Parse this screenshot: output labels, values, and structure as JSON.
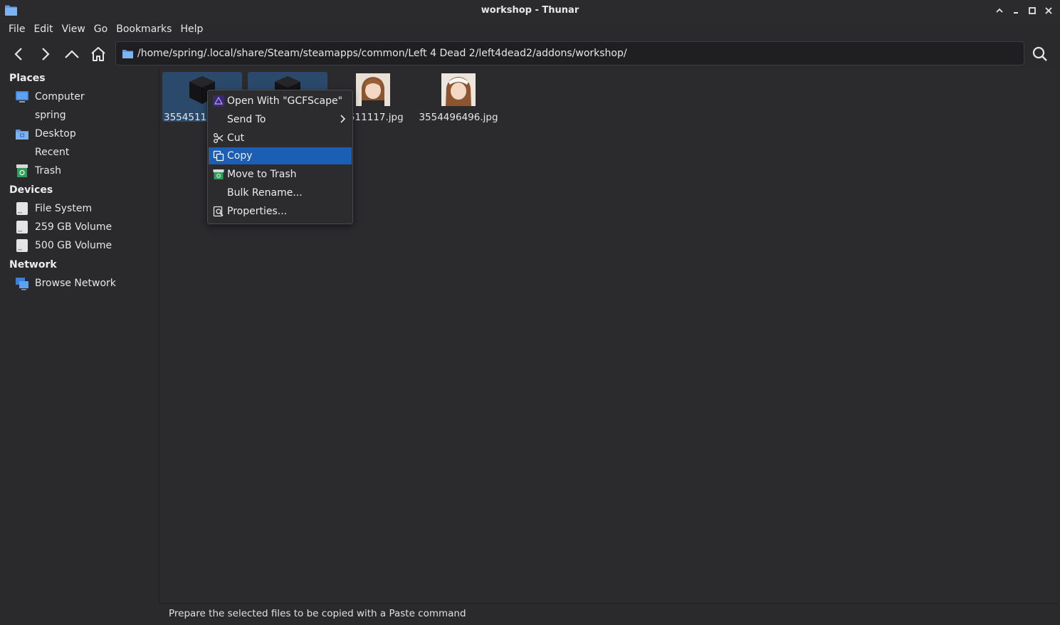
{
  "window": {
    "title": "workshop - Thunar"
  },
  "menubar": {
    "items": [
      "File",
      "Edit",
      "View",
      "Go",
      "Bookmarks",
      "Help"
    ]
  },
  "toolbar": {
    "path": "/home/spring/.local/share/Steam/steamapps/common/Left 4 Dead 2/left4dead2/addons/workshop/"
  },
  "sidebar": {
    "places": {
      "title": "Places",
      "items": [
        {
          "label": "Computer",
          "icon": "computer-icon"
        },
        {
          "label": "spring",
          "icon": "home-icon"
        },
        {
          "label": "Desktop",
          "icon": "desktop-folder-icon"
        },
        {
          "label": "Recent",
          "icon": "recent-icon"
        },
        {
          "label": "Trash",
          "icon": "trash-icon"
        }
      ]
    },
    "devices": {
      "title": "Devices",
      "items": [
        {
          "label": "File System",
          "icon": "drive-icon"
        },
        {
          "label": "259 GB Volume",
          "icon": "drive-icon"
        },
        {
          "label": "500 GB Volume",
          "icon": "drive-icon"
        }
      ]
    },
    "network": {
      "title": "Network",
      "items": [
        {
          "label": "Browse Network",
          "icon": "network-icon"
        }
      ]
    }
  },
  "files": [
    {
      "name": "35545111",
      "type": "vpk",
      "selected": true
    },
    {
      "name": "",
      "type": "vpk",
      "selected": true
    },
    {
      "name": "4511117.jpg",
      "type": "jpg",
      "selected": false
    },
    {
      "name": "3554496496.jpg",
      "type": "jpg",
      "selected": false
    }
  ],
  "context_menu": {
    "items": [
      {
        "label": "Open With \"GCFScape\"",
        "icon": "gcfscape-icon"
      },
      {
        "label": "Send To",
        "icon": "",
        "submenu": true
      },
      {
        "label": "Cut",
        "icon": "cut-icon"
      },
      {
        "label": "Copy",
        "icon": "copy-icon",
        "active": true
      },
      {
        "label": "Move to Trash",
        "icon": "trash-icon"
      },
      {
        "label": "Bulk Rename...",
        "icon": ""
      },
      {
        "label": "Properties...",
        "icon": "properties-icon"
      }
    ]
  },
  "statusbar": {
    "text": "Prepare the selected files to be copied with a Paste command"
  },
  "colors": {
    "accent": "#1a5fb4",
    "selection": "#2b4a6b",
    "background": "#2b2b2e",
    "folder": "#5c9ce6"
  }
}
